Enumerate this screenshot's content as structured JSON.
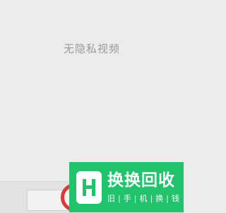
{
  "screen": {
    "empty_message": "无隐私视频"
  },
  "watermark": {
    "title": "换换回收",
    "subtitle_chars": [
      "旧",
      "手",
      "机",
      "换",
      "钱"
    ],
    "separator": "|"
  },
  "colors": {
    "background": "#ececec",
    "record_ring": "#d63c35",
    "watermark_green": "#22c36d"
  }
}
